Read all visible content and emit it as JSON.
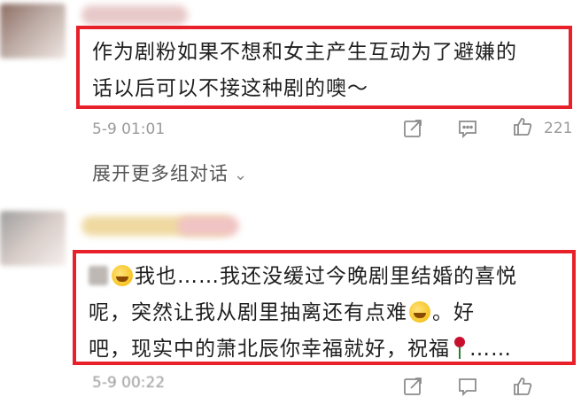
{
  "comments": [
    {
      "text_lines": [
        "作为剧粉如果不想和女主产生互动为了避嫌的",
        "话以后可以不接这种剧的噢～"
      ],
      "time": "5-9 01:01",
      "likes": "221",
      "expand_label": "展开更多组对话",
      "expand_icon": "chevron-down-icon"
    },
    {
      "text_lines": [
        "我也……我还没缓过今晚剧里结婚的喜悦",
        "呢，突然让我从剧里抽离还有点难",
        "。好",
        "吧，现实中的萧北辰你幸福就好，祝福",
        "……"
      ],
      "time": "5-9 00:22"
    }
  ],
  "icons": {
    "share": "share-icon",
    "comment": "comment-icon",
    "like": "thumbs-up-icon"
  },
  "colors": {
    "highlight_border": "#e8202a",
    "meta_text": "#9a9a9a"
  }
}
